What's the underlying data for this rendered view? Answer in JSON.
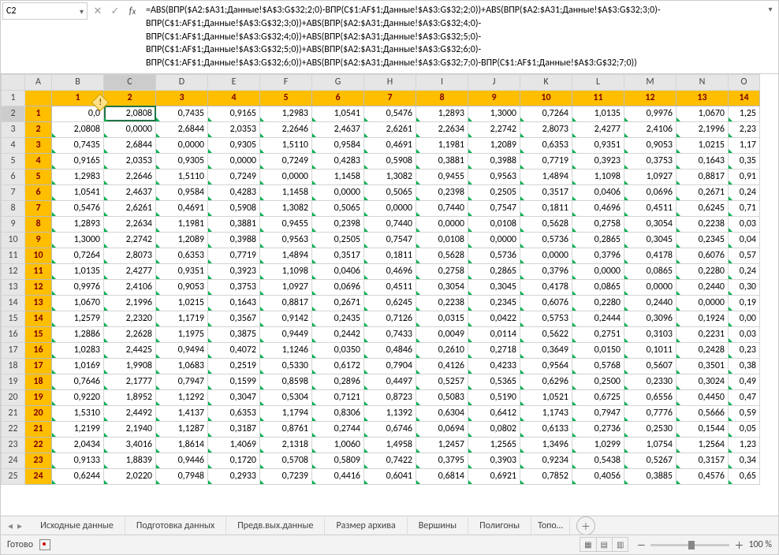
{
  "namebox": "C2",
  "formula": "=ABS(ВПР($A2:$A31;Данные!$A$3:G$32;2;0)-ВПР(C$1:AF$1;Данные!$A$3:G$32;2;0))+ABS(ВПР($A2:$A31;Данные!$A$3:G$32;3;0)-ВПР(C$1:AF$1;Данные!$A$3:G$32;3;0))+ABS(ВПР($A2:$A31;Данные!$A$3:G$32;4;0)-ВПР(C$1:AF$1;Данные!$A$3:G$32;4;0))+ABS(ВПР($A2:$A31;Данные!$A$3:G$32;5;0)-ВПР(C$1:AF$1;Данные!$A$3:G$32;5;0))+ABS(ВПР($A2:$A31;Данные!$A$3:G$32;6;0)-ВПР(C$1:AF$1;Данные!$A$3:G$32;6;0))+ABS(ВПР($A2:$A31;Данные!$A$3:G$32;7;0)-ВПР(C$1:AF$1;Данные!$A$3:G$32;7;0))",
  "cols": [
    "A",
    "B",
    "C",
    "D",
    "E",
    "F",
    "G",
    "H",
    "I",
    "J",
    "K",
    "L",
    "M",
    "N",
    "O"
  ],
  "colHeaders": [
    "",
    "1",
    "2",
    "3",
    "4",
    "5",
    "6",
    "7",
    "8",
    "9",
    "10",
    "11",
    "12",
    "13",
    "14"
  ],
  "rows": [
    {
      "n": 2,
      "lbl": "1",
      "v": [
        "0,0",
        "2,0808",
        "0,7435",
        "0,9165",
        "1,2983",
        "1,0541",
        "0,5476",
        "1,2893",
        "1,3000",
        "0,7264",
        "1,0135",
        "0,9976",
        "1,0670",
        "1,25"
      ]
    },
    {
      "n": 3,
      "lbl": "2",
      "v": [
        "2,0808",
        "0,0000",
        "2,6844",
        "2,0353",
        "2,2646",
        "2,4637",
        "2,6261",
        "2,2634",
        "2,2742",
        "2,8073",
        "2,4277",
        "2,4106",
        "2,1996",
        "2,23"
      ]
    },
    {
      "n": 4,
      "lbl": "3",
      "v": [
        "0,7435",
        "2,6844",
        "0,0000",
        "0,9305",
        "1,5110",
        "0,9584",
        "0,4691",
        "1,1981",
        "1,2089",
        "0,6353",
        "0,9351",
        "0,9053",
        "1,0215",
        "1,17"
      ]
    },
    {
      "n": 5,
      "lbl": "4",
      "v": [
        "0,9165",
        "2,0353",
        "0,9305",
        "0,0000",
        "0,7249",
        "0,4283",
        "0,5908",
        "0,3881",
        "0,3988",
        "0,7719",
        "0,3923",
        "0,3753",
        "0,1643",
        "0,35"
      ]
    },
    {
      "n": 6,
      "lbl": "5",
      "v": [
        "1,2983",
        "2,2646",
        "1,5110",
        "0,7249",
        "0,0000",
        "1,1458",
        "1,3082",
        "0,9455",
        "0,9563",
        "1,4894",
        "1,1098",
        "1,0927",
        "0,8817",
        "0,91"
      ]
    },
    {
      "n": 7,
      "lbl": "6",
      "v": [
        "1,0541",
        "2,4637",
        "0,9584",
        "0,4283",
        "1,1458",
        "0,0000",
        "0,5065",
        "0,2398",
        "0,2505",
        "0,3517",
        "0,0406",
        "0,0696",
        "0,2671",
        "0,24"
      ]
    },
    {
      "n": 8,
      "lbl": "7",
      "v": [
        "0,5476",
        "2,6261",
        "0,4691",
        "0,5908",
        "1,3082",
        "0,5065",
        "0,0000",
        "0,7440",
        "0,7547",
        "0,1811",
        "0,4696",
        "0,4511",
        "0,6245",
        "0,71"
      ]
    },
    {
      "n": 9,
      "lbl": "8",
      "v": [
        "1,2893",
        "2,2634",
        "1,1981",
        "0,3881",
        "0,9455",
        "0,2398",
        "0,7440",
        "0,0000",
        "0,0108",
        "0,5628",
        "0,2758",
        "0,3054",
        "0,2238",
        "0,03"
      ]
    },
    {
      "n": 10,
      "lbl": "9",
      "v": [
        "1,3000",
        "2,2742",
        "1,2089",
        "0,3988",
        "0,9563",
        "0,2505",
        "0,7547",
        "0,0108",
        "0,0000",
        "0,5736",
        "0,2865",
        "0,3045",
        "0,2345",
        "0,04"
      ]
    },
    {
      "n": 11,
      "lbl": "10",
      "v": [
        "0,7264",
        "2,8073",
        "0,6353",
        "0,7719",
        "1,4894",
        "0,3517",
        "0,1811",
        "0,5628",
        "0,5736",
        "0,0000",
        "0,3796",
        "0,4178",
        "0,6076",
        "0,57"
      ]
    },
    {
      "n": 12,
      "lbl": "11",
      "v": [
        "1,0135",
        "2,4277",
        "0,9351",
        "0,3923",
        "1,1098",
        "0,0406",
        "0,4696",
        "0,2758",
        "0,2865",
        "0,3796",
        "0,0000",
        "0,0865",
        "0,2280",
        "0,24"
      ]
    },
    {
      "n": 13,
      "lbl": "12",
      "v": [
        "0,9976",
        "2,4106",
        "0,9053",
        "0,3753",
        "1,0927",
        "0,0696",
        "0,4511",
        "0,3054",
        "0,3045",
        "0,4178",
        "0,0865",
        "0,0000",
        "0,2440",
        "0,30"
      ]
    },
    {
      "n": 14,
      "lbl": "13",
      "v": [
        "1,0670",
        "2,1996",
        "1,0215",
        "0,1643",
        "0,8817",
        "0,2671",
        "0,6245",
        "0,2238",
        "0,2345",
        "0,6076",
        "0,2280",
        "0,2440",
        "0,0000",
        "0,19"
      ]
    },
    {
      "n": 15,
      "lbl": "14",
      "v": [
        "1,2579",
        "2,2320",
        "1,1719",
        "0,3567",
        "0,9142",
        "0,2435",
        "0,7126",
        "0,0315",
        "0,0422",
        "0,5753",
        "0,2444",
        "0,3096",
        "0,1924",
        "0,00"
      ]
    },
    {
      "n": 16,
      "lbl": "15",
      "v": [
        "1,2886",
        "2,2628",
        "1,1975",
        "0,3875",
        "0,9449",
        "0,2442",
        "0,7433",
        "0,0049",
        "0,0114",
        "0,5622",
        "0,2751",
        "0,3103",
        "0,2231",
        "0,03"
      ]
    },
    {
      "n": 17,
      "lbl": "16",
      "v": [
        "1,0283",
        "2,4425",
        "0,9494",
        "0,4072",
        "1,1246",
        "0,0350",
        "0,4846",
        "0,2610",
        "0,2718",
        "0,3649",
        "0,0150",
        "0,1011",
        "0,2428",
        "0,23"
      ]
    },
    {
      "n": 18,
      "lbl": "17",
      "v": [
        "1,0169",
        "1,9908",
        "1,0683",
        "0,2519",
        "0,5330",
        "0,6172",
        "0,7904",
        "0,4126",
        "0,4233",
        "0,9564",
        "0,5768",
        "0,5607",
        "0,3501",
        "0,38"
      ]
    },
    {
      "n": 19,
      "lbl": "18",
      "v": [
        "0,7646",
        "2,1777",
        "0,7947",
        "0,1599",
        "0,8598",
        "0,2896",
        "0,4497",
        "0,5257",
        "0,5365",
        "0,6296",
        "0,2500",
        "0,2330",
        "0,3024",
        "0,49"
      ]
    },
    {
      "n": 20,
      "lbl": "19",
      "v": [
        "0,9220",
        "1,8952",
        "1,1292",
        "0,3047",
        "0,5304",
        "0,7121",
        "0,8723",
        "0,5083",
        "0,5190",
        "1,0521",
        "0,6725",
        "0,6556",
        "0,4450",
        "0,47"
      ]
    },
    {
      "n": 21,
      "lbl": "20",
      "v": [
        "1,5310",
        "2,4492",
        "1,4137",
        "0,6353",
        "1,1794",
        "0,8306",
        "1,1392",
        "0,6304",
        "0,6412",
        "1,1743",
        "0,7947",
        "0,7776",
        "0,5666",
        "0,59"
      ]
    },
    {
      "n": 22,
      "lbl": "21",
      "v": [
        "1,2199",
        "2,1940",
        "1,1287",
        "0,3187",
        "0,8761",
        "0,2744",
        "0,6746",
        "0,0694",
        "0,0802",
        "0,6133",
        "0,2736",
        "0,2530",
        "0,1544",
        "0,05"
      ]
    },
    {
      "n": 23,
      "lbl": "22",
      "v": [
        "2,0434",
        "3,4016",
        "1,8614",
        "1,4069",
        "2,1318",
        "1,0060",
        "1,4958",
        "1,2457",
        "1,2565",
        "1,3496",
        "1,0299",
        "1,0754",
        "1,2564",
        "1,23"
      ]
    },
    {
      "n": 24,
      "lbl": "23",
      "v": [
        "0,9133",
        "1,8839",
        "0,9446",
        "0,1720",
        "0,5708",
        "0,5809",
        "0,7422",
        "0,3795",
        "0,3903",
        "0,9234",
        "0,5438",
        "0,5267",
        "0,3157",
        "0,34"
      ]
    },
    {
      "n": 25,
      "lbl": "24",
      "v": [
        "0,6244",
        "2,0220",
        "0,7948",
        "0,2933",
        "0,7239",
        "0,4416",
        "0,6041",
        "0,6814",
        "0,6921",
        "0,7852",
        "0,4056",
        "0,3885",
        "0,4576",
        "0,65"
      ]
    }
  ],
  "tabs": [
    "Исходные данные",
    "Подготовка данных",
    "Предв.вых.данные",
    "Размер архива",
    "Вершины",
    "Полигоны",
    "Топо…"
  ],
  "status": "Готово",
  "zoom": "100 %"
}
